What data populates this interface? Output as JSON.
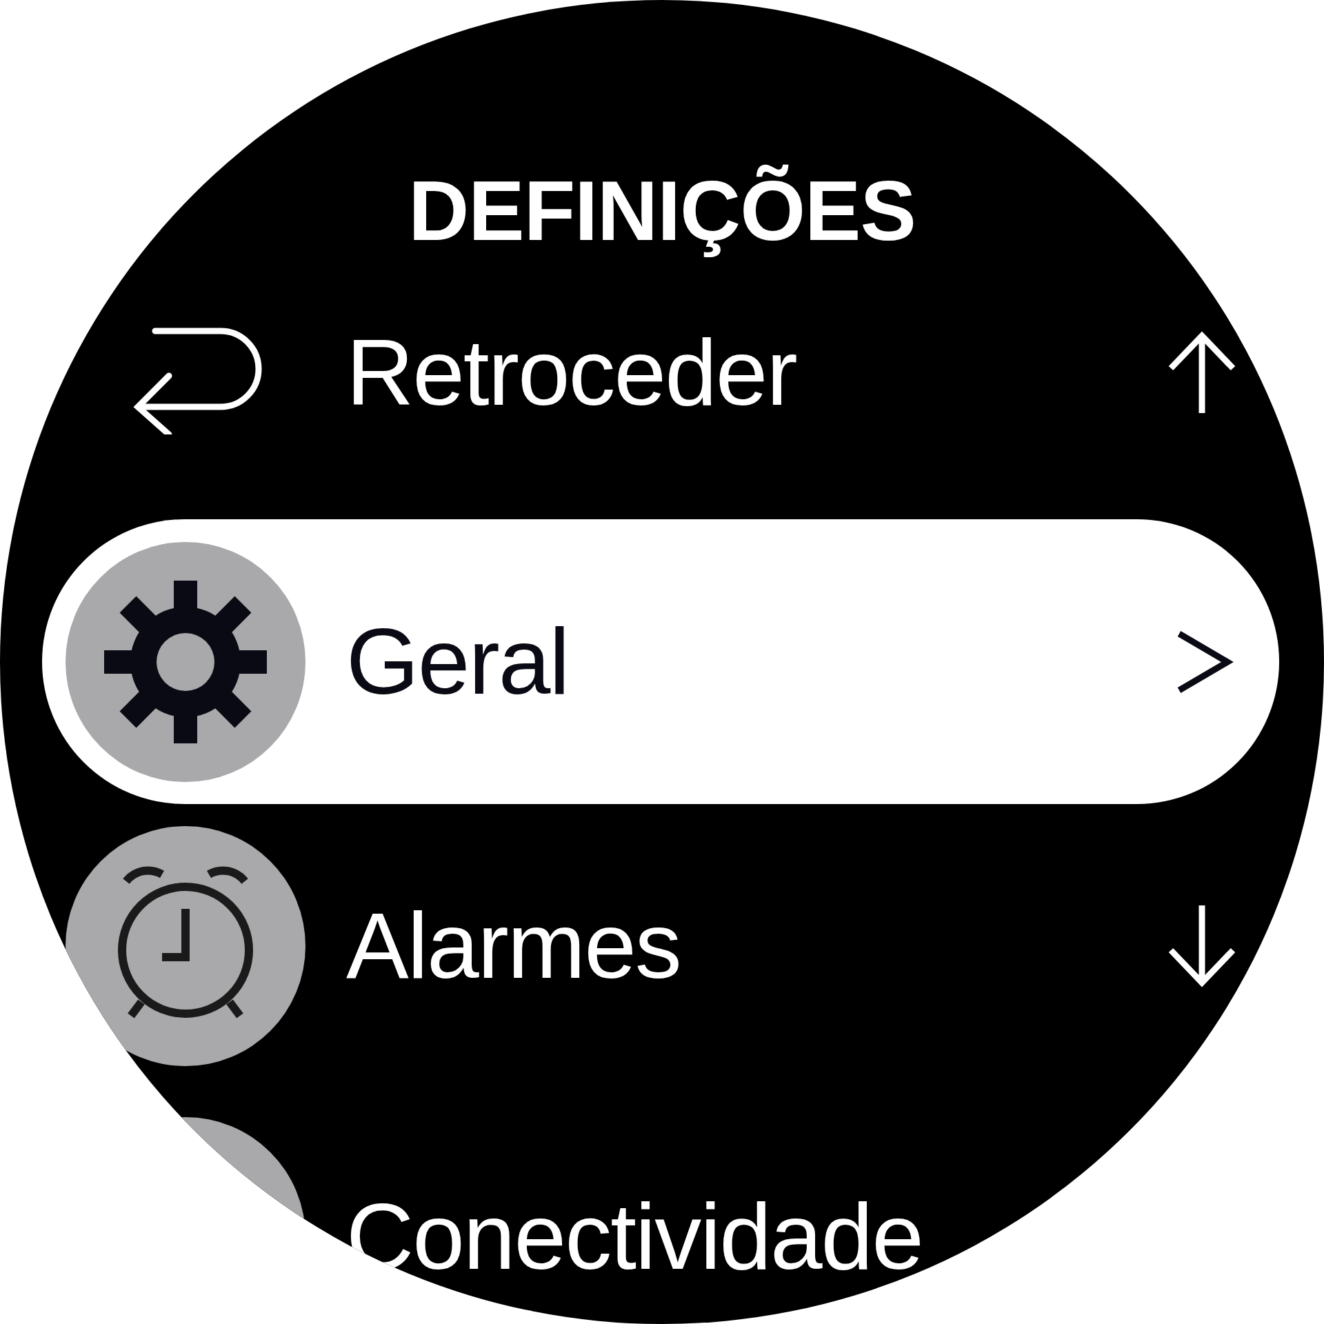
{
  "title": "DEFINIÇÕES",
  "items": [
    {
      "label": "Retroceder",
      "kind": "back",
      "selected": false
    },
    {
      "label": "Geral",
      "kind": "menu",
      "selected": true
    },
    {
      "label": "Alarmes",
      "kind": "menu",
      "selected": false
    },
    {
      "label": "Conectividade",
      "kind": "menu",
      "selected": false
    }
  ]
}
